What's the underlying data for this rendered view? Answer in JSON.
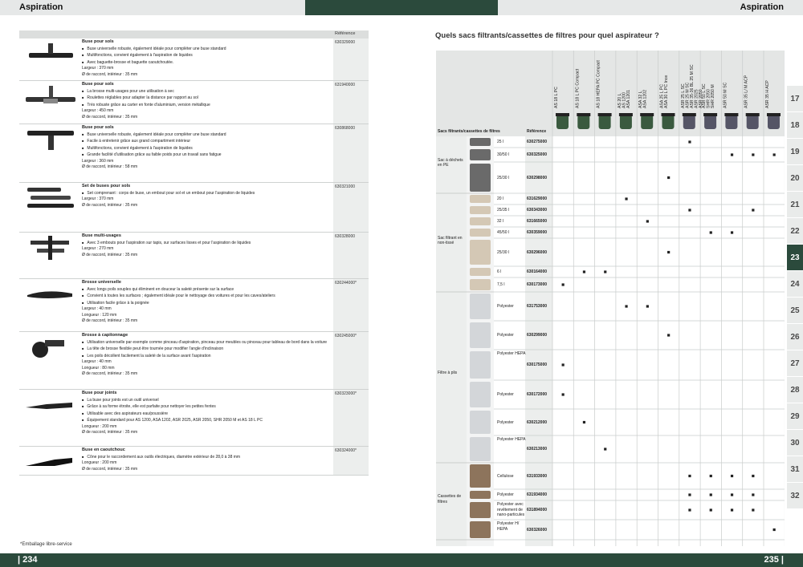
{
  "header": {
    "left_title": "Aspiration",
    "right_title": "Aspiration"
  },
  "footer": {
    "left_page": "| 234",
    "right_page": "235 |",
    "footnote": "*Emballage libre-service"
  },
  "left_table": {
    "ref_header": "Référence",
    "products": [
      {
        "title": "Buse pour sols",
        "ref": "630329000",
        "lines": [
          "Buse universelle robuste, également idéale pour compléter une buse standard",
          "Multifonctions, convient également à l'aspiration de liquides",
          "Avec baguette-brosse et baguette caoutchoutée."
        ],
        "specs": [
          "Largeur : 370 mm",
          "Ø de raccord, intérieur : 35 mm"
        ]
      },
      {
        "title": "Buse pour sols",
        "ref": "631940000",
        "lines": [
          "La brosse multi-usages pour une utilisation à sec",
          "Roulettes réglables pour adapter la distance par rapport au sol",
          "Très robuste grâce au carter en fonte d'aluminium, version métallique"
        ],
        "specs": [
          "Largeur : 450 mm",
          "Ø de raccord, intérieur : 35 mm"
        ]
      },
      {
        "title": "Buse pour sols",
        "ref": "630868000",
        "lines": [
          "Buse universelle robuste, également idéale pour compléter une buse standard",
          "Facile à entretenir grâce aux grand compartiment intérieur",
          "Multifonctions, convient également à l'aspiration de liquides",
          "Grande facilité d'utilisation grâce au faible poids pour un travail sans fatigue"
        ],
        "specs": [
          "Largeur : 360 mm",
          "Ø de raccord, intérieur : 58 mm"
        ]
      },
      {
        "title": "Set de buses pour sols",
        "ref": "630321000",
        "lines": [
          "Set comprenant : corps de buse, un embout pour sol et un embout pour l'aspiration de liquides"
        ],
        "specs": [
          "Largeur : 370 mm",
          "Ø de raccord, intérieur : 35 mm"
        ]
      },
      {
        "title": "Buse multi-usages",
        "ref": "630328000",
        "lines": [
          "Avec 3 embouts pour l'aspiration sur tapis, sur surfaces lisses et pour l'aspiration de liquides"
        ],
        "specs": [
          "Largeur : 270 mm",
          "Ø de raccord, intérieur : 35 mm"
        ]
      },
      {
        "title": "Brosse universelle",
        "ref": "630244000*",
        "lines": [
          "Avec longs poils souples qui éliminent en douceur la saleté présente sur la surface",
          "Convient à toutes les surfaces ; également idéale pour le nettoyage des voitures et pour les caves/ateliers",
          "Utilisation facile grâce à la poignée"
        ],
        "specs": [
          "Largeur : 40 mm",
          "Longueur : 120 mm",
          "Ø de raccord, intérieur : 35 mm"
        ]
      },
      {
        "title": "Brosse à capitonnage",
        "ref": "630245000*",
        "lines": [
          "Utilisation universelle par exemple comme pinceau d'aspiration, pinceau pour meubles ou pinceau pour tableau de bord dans la voiture",
          "La tête de brosse flexible peut être tournée pour modifier l'angle d'inclinaison",
          "Les poils décollent facilement la saleté de la surface avant l'aspiration"
        ],
        "specs": [
          "Largeur : 40 mm",
          "Longueur : 80 mm",
          "Ø de raccord, intérieur : 35 mm"
        ]
      },
      {
        "title": "Buse pour joints",
        "ref": "630323000*",
        "lines": [
          "La buse pour joints est un outil universel",
          "Grâce à sa forme étroite, elle est parfaite pour nettoyer les petites fentes",
          "Utilisable avec des aspirateurs eau/poussière",
          "Équipement standard pour AS 1200, ASA 1202, ASR 2025, ASR 2050, SHR 2050 M et AS 18 L PC"
        ],
        "specs": [
          "Longueur : 200 mm",
          "Ø de raccord, intérieur : 35 mm"
        ]
      },
      {
        "title": "Buse en caoutchouc",
        "ref": "630324000*",
        "lines": [
          "Cône pour le raccordement aux outils électriques, diamètre extérieur de 28,0 à 38 mm"
        ],
        "specs": [
          "Longueur : 200 mm",
          "Ø de raccord, intérieur : 35 mm"
        ]
      }
    ]
  },
  "right": {
    "title": "Quels sacs filtrants/cassettes de filtres pour quel aspirateur ?",
    "col_header_type": "Sacs filtrants/cassettes de filtres",
    "col_header_ref": "Référence",
    "machines": [
      "AS 18 L PC",
      "AS 18 L PC Compact",
      "AS 18 HEPA PC Compact",
      "AS 20 L\nAS 1200\nASA 1201",
      "ASA 32 L\nASA 1202",
      "ASA 25 L PC\nASA 30 L PC Inox",
      "ASR 25 L SC\nASR 25 M SC\nASR 35-36 BL 25 M SC\nASR 2025\nASR 2050",
      "ASR 50 L SC\nSHR 2050\nSHR 2050 M",
      "ASR 50 M SC",
      "ASR 35 L/ M ACP",
      "ASR 35 H ACP"
    ],
    "groups": [
      "Sac à déchets en PE",
      "Sac filtrant en non-tissé",
      "Filtre à plis",
      "Cassettes de filtres"
    ],
    "rows": [
      {
        "label": "25 l",
        "ref": "630275000",
        "marks": [
          6
        ]
      },
      {
        "label": "30/50 l",
        "ref": "630325000",
        "marks": [
          8,
          9,
          10
        ]
      },
      {
        "label": "25/30 l",
        "ref": "630298000",
        "marks": [
          5
        ]
      },
      {
        "label": "20 l",
        "ref": "631629000",
        "marks": [
          3
        ]
      },
      {
        "label": "25/35 l",
        "ref": "630343000",
        "marks": [
          6,
          9
        ]
      },
      {
        "label": "32 l",
        "ref": "631665000",
        "marks": [
          4
        ]
      },
      {
        "label": "45/50 l",
        "ref": "630359000",
        "marks": [
          7,
          8
        ]
      },
      {
        "label": "25/30 l",
        "ref": "630296000",
        "marks": [
          5
        ]
      },
      {
        "label": "6 l",
        "ref": "630164000",
        "marks": [
          1,
          2
        ]
      },
      {
        "label": "7,5 l",
        "ref": "630173000",
        "marks": [
          0
        ]
      },
      {
        "label": "Polyester",
        "ref": "631753000",
        "marks": [
          3,
          4
        ]
      },
      {
        "label": "Polyester",
        "ref": "630299000",
        "marks": [
          5
        ]
      },
      {
        "label": "Polyester HEPA",
        "ref": "630175000",
        "marks": [
          0
        ]
      },
      {
        "label": "Polyester",
        "ref": "630172000",
        "marks": [
          0
        ]
      },
      {
        "label": "Polyester",
        "ref": "630212000",
        "marks": [
          1
        ]
      },
      {
        "label": "Polyester HEPA",
        "ref": "630213000",
        "marks": [
          2
        ]
      },
      {
        "label": "Cellulose",
        "ref": "631933000",
        "marks": [
          6,
          7,
          8,
          9
        ]
      },
      {
        "label": "Polyester",
        "ref": "631934000",
        "marks": [
          6,
          7,
          8,
          9
        ]
      },
      {
        "label": "Polyester avec revêtement de nano-particules",
        "ref": "631894000",
        "marks": [
          6,
          7,
          8,
          9
        ]
      },
      {
        "label": "Polyester H/ HEPA",
        "ref": "630326000",
        "marks": [
          10
        ]
      }
    ],
    "page_tabs": [
      "17",
      "18",
      "19",
      "20",
      "21",
      "22",
      "23",
      "24",
      "25",
      "26",
      "27",
      "28",
      "29",
      "30",
      "31",
      "32"
    ],
    "active_tab": "23"
  }
}
